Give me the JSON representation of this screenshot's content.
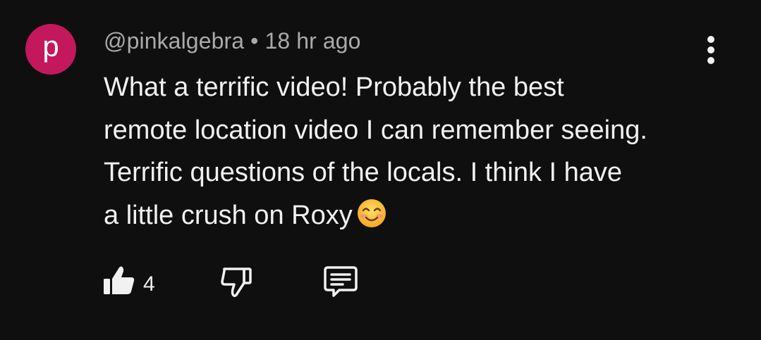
{
  "comment": {
    "avatar_letter": "p",
    "avatar_color": "#c3185c",
    "author": "@pinkalgebra",
    "separator": "•",
    "time": "18 hr ago",
    "text": "What a terrific video!  Probably the best\nremote location video I can remember seeing.\nTerrific questions of the locals.  I think I have\na little crush on Roxy",
    "emoji": "smiling-face-with-smiling-eyes",
    "likes": "4"
  },
  "icons": {
    "like": "thumbs-up-filled",
    "dislike": "thumbs-down-outline",
    "reply": "comment-outline",
    "more": "vertical-ellipsis"
  },
  "colors": {
    "background": "#0f0f0f",
    "text": "#f1f1f1",
    "secondary_text": "#aaaaaa"
  }
}
